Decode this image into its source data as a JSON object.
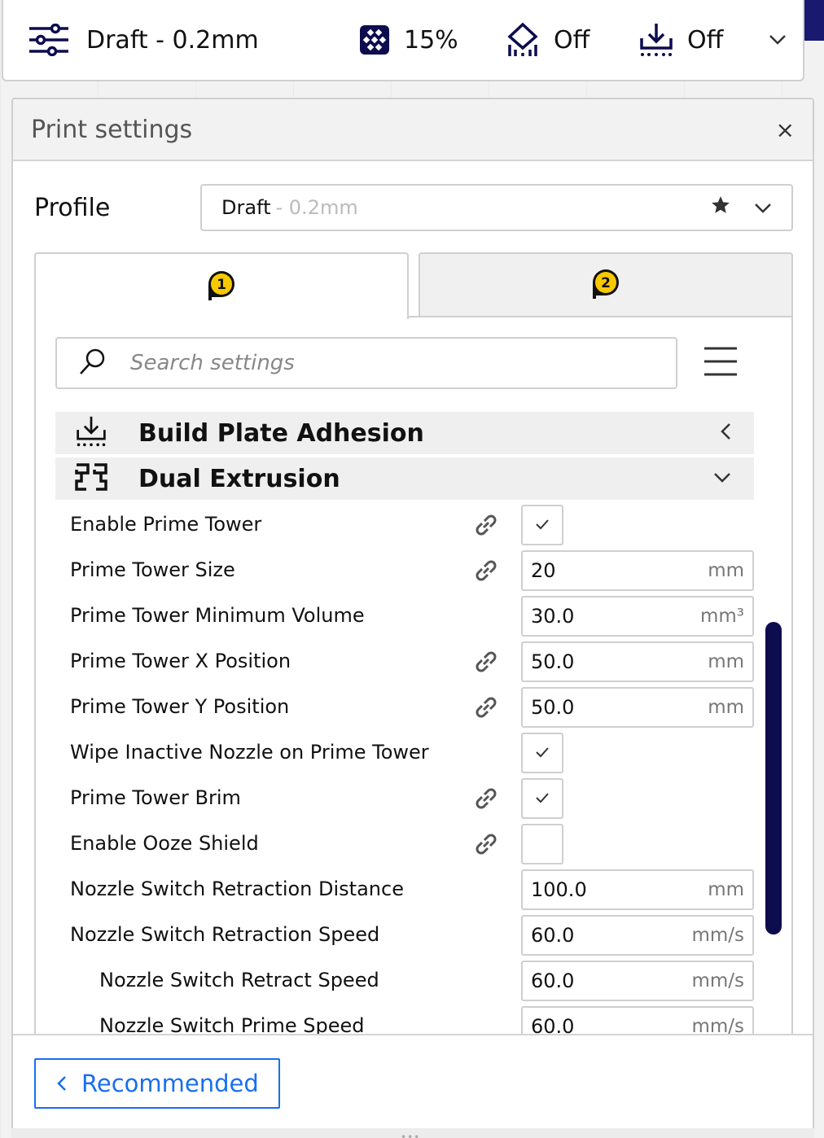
{
  "topbar": {
    "profile": "Draft - 0.2mm",
    "infill": "15%",
    "support": "Off",
    "adhesion": "Off"
  },
  "panel": {
    "title": "Print settings",
    "close": "×",
    "profile_label": "Profile",
    "profile_name": "Draft",
    "profile_layer": "- 0.2mm"
  },
  "tabs": [
    {
      "label": "1",
      "active": true
    },
    {
      "label": "2",
      "active": false
    }
  ],
  "search": {
    "placeholder": "Search settings"
  },
  "categories": {
    "adhesion": "Build Plate Adhesion",
    "dual": "Dual Extrusion"
  },
  "settings": [
    {
      "label": "Enable Prime Tower",
      "type": "check",
      "checked": true,
      "linked": true
    },
    {
      "label": "Prime Tower Size",
      "type": "value",
      "value": "20",
      "unit": "mm",
      "linked": true
    },
    {
      "label": "Prime Tower Minimum Volume",
      "type": "value",
      "value": "30.0",
      "unit": "mm³",
      "linked": false
    },
    {
      "label": "Prime Tower X Position",
      "type": "value",
      "value": "50.0",
      "unit": "mm",
      "linked": true
    },
    {
      "label": "Prime Tower Y Position",
      "type": "value",
      "value": "50.0",
      "unit": "mm",
      "linked": true
    },
    {
      "label": "Wipe Inactive Nozzle on Prime Tower",
      "type": "check",
      "checked": true,
      "linked": false
    },
    {
      "label": "Prime Tower Brim",
      "type": "check",
      "checked": true,
      "linked": true
    },
    {
      "label": "Enable Ooze Shield",
      "type": "check",
      "checked": false,
      "linked": true
    },
    {
      "label": "Nozzle Switch Retraction Distance",
      "type": "value",
      "value": "100.0",
      "unit": "mm",
      "linked": false
    },
    {
      "label": "Nozzle Switch Retraction Speed",
      "type": "value",
      "value": "60.0",
      "unit": "mm/s",
      "linked": false
    },
    {
      "label": "Nozzle Switch Retract Speed",
      "type": "value",
      "value": "60.0",
      "unit": "mm/s",
      "linked": false,
      "indent": true
    },
    {
      "label": "Nozzle Switch Prime Speed",
      "type": "value",
      "value": "60.0",
      "unit": "mm/s",
      "linked": false,
      "indent": true
    }
  ],
  "footer": {
    "recommended": "Recommended"
  },
  "colors": {
    "accent": "#196ef0",
    "dark": "#0c0c4f",
    "extruder_badge": "#f8c900"
  }
}
